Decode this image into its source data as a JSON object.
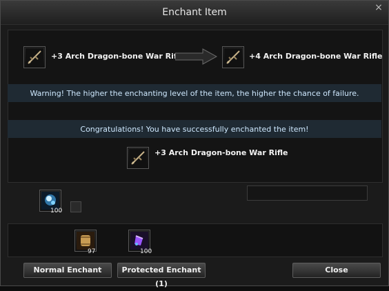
{
  "window": {
    "title": "Enchant Item",
    "close_glyph": "×"
  },
  "top_row": {
    "current_item_name": "+3 Arch Dragon-bone War Rifle",
    "target_item_name": "+4 Arch Dragon-bone War Rifle",
    "current_item_icon": "rifle-icon",
    "target_item_icon": "rifle-icon",
    "arrow_icon": "right-arrow-icon"
  },
  "messages": {
    "warning": "Warning! The higher the enchanting level of the item, the higher the chance of failure.",
    "result": "Congratulations! You have successfully enchanted the item!"
  },
  "result_item": {
    "name": "+3 Arch Dragon-bone War Rifle",
    "icon": "rifle-icon"
  },
  "materials": {
    "catalyst_count": "100",
    "catalyst_icon": "enchant-stone-icon"
  },
  "consumables": [
    {
      "icon": "scroll-icon",
      "count": "97"
    },
    {
      "icon": "protect-gem-icon",
      "count": "100"
    }
  ],
  "buttons": {
    "normal_enchant": "Normal Enchant",
    "protected_enchant": "Protected Enchant (1)",
    "close": "Close"
  },
  "colors": {
    "banner_bg": "#1f2a33",
    "banner_text": "#cfe9ff"
  }
}
